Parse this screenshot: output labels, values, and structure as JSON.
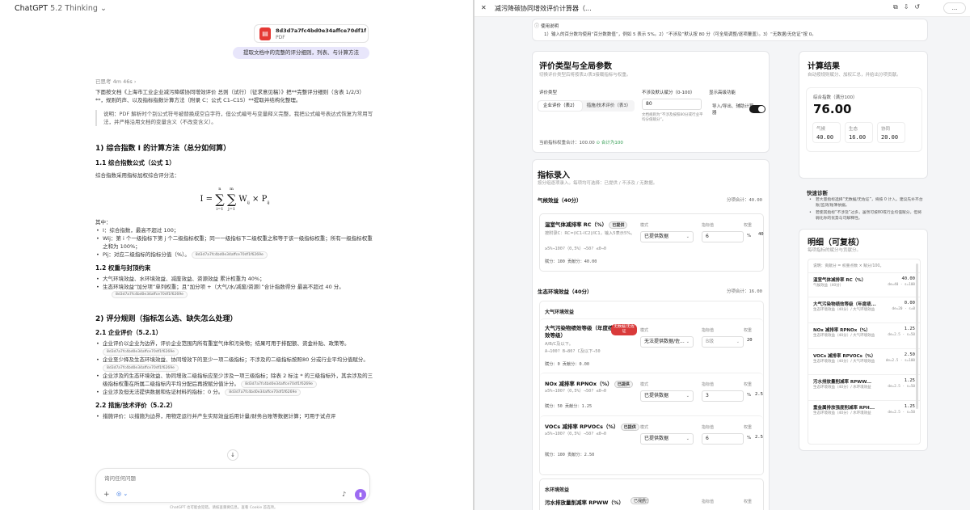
{
  "chat": {
    "title": "ChatGPT",
    "version": "5.2 Thinking",
    "file_name": "8d3d7a7fc4bd0e34affce70df1f62...",
    "file_type": "PDF",
    "user_message": "提取文档中的完整的评分细则，列表、与计算方法",
    "thought_time": "已思考 4m 46s",
    "intro": "下面按文档《上海市工业企业减污降碳协同增效评价 总则（试行）（征求意见稿）》把**完整评分细则（含表 1/2/3）**，规则的声、以及指标指数计算方法（附录 C：公式 C1–C15）**提取并结构化整理。",
    "note": "说明：PDF 解析时个别公式符号被替换成空白字符，但公式编号与变量释义完整，我把公式编号表达式恢复为常用写法，并严格沿用文档的变量含义（不改变含义）。",
    "sec1_title": "1) 综合指数 I 的计算方法（总分如何算）",
    "sec1_1_title": "1.1 综合指数公式（公式 1）",
    "sec1_1_text": "综合指数采用指标加权综合评分法：",
    "formula_lhs": "I =",
    "formula_n": "n",
    "formula_m": "m",
    "formula_i": "i=1",
    "formula_j": "j=1",
    "formula_body": "W",
    "formula_body_sub": "ij",
    "formula_times": "× P",
    "formula_p_sub": "ij",
    "where_label": "其中：",
    "where_items": [
      "I：综合指数，最高不超过 100；",
      "Wij：第 i 个一级指标下第 j 个二级指标权重；同一一级指标下二级权重之和等于该一级指标权重；所有一级指标权重之和为 100%；",
      "Pij：对应二级指标的指标分值（%）。"
    ],
    "ref_chip": "8d3d7a7fc4bd0e34affce70df1f6269e",
    "sec1_2_title": "1.2 权重与封顶约束",
    "sec1_2_items": [
      "大气环境效益、水环境效益、减废效益、资源效益 累计权重为 40%；",
      "生态环境效益“加分项”单列权重；且“加分项 +（大气/水/减废/资源）”合计指数得分 最高不超过 40 分。"
    ],
    "sec2_title": "2) 评分规则（指标怎么选、缺失怎么处理）",
    "sec2_1_title": "2.1 企业评价（5.2.1）",
    "sec2_1_items": [
      "企业评价以企业为边界，评价企业范围内所有重室气体和污染物；结果可用于排配额、资金补贴、政策等。",
      "企业至少择及生态环境效益、协同增效下的至少一项二级指标；不涉及的二级指标按照80 分或行业平均分值赋分。",
      "企业涉及的生态环境效益、协同增效二级指标应至少涉及一项三级指标；除表 2 标注 * 的三级指标外，其余涉及的三级指标权重在所属二级指标内平均分配后再按赋分值计分。",
      "企业涉及但无法提供数据和佐证材料的指标：0 分。"
    ],
    "sec2_2_title": "2.2 措施/技术评价（5.2.2）",
    "sec2_2_items": [
      "措施评价：以措施为边界，用物定运行并产生实际效益后用计量/财务台账等数据计算；可用于试点评"
    ],
    "composer_placeholder": "询问任何问题",
    "disclaimer": "ChatGPT 也可能会犯错。请核查重要信息。查看 Cookie 首选项。"
  },
  "canvas": {
    "title": "减污降碳协同增效评价计算器（...",
    "share_label": "...",
    "note_title": "使用说明",
    "note_text": "1）输入的百分数均使用“百分数数值”，例如 5 表示 5%。2）“不涉及”默认按 80 分（可全局调整/逐项覆盖）。3）“无数据/无佐证”按 0。",
    "params": {
      "title": "评价类型与全局参数",
      "subtitle": "切换评价类型后将按表2/表3接载指标与权重。",
      "type_label": "评价类型",
      "type_options": [
        "企业评价（表2）",
        "措施/技术评价（表3）"
      ],
      "default_label": "不涉及默认赋分（0-100）",
      "default_value": "80",
      "default_hint": "文档规则为“不涉及按照80分或行业平均分值赋分”。",
      "adv_label": "显示高级功能",
      "adv_text": "导入/导出、辅助计算器",
      "weight_total": "当前指标权重合计：100.00",
      "weight_ok": "合计为100"
    },
    "result": {
      "title": "计算结果",
      "subtitle": "自动按规则赋分、加权汇总，并给出分项贡献。",
      "total_label": "综合指数（满分100）",
      "total_value": "76.00",
      "subs": [
        {
          "label": "气候",
          "value": "40.00"
        },
        {
          "label": "生态",
          "value": "16.00"
        },
        {
          "label": "协同",
          "value": "20.00"
        }
      ]
    },
    "diag": {
      "title": "快速诊断",
      "items": [
        "若大量指标选择“无数据/无佐证”，将按 0 计入。建议先补齐台账/监测/账簿依据。",
        "若使其指标“不涉及”过多，虽然可按80或行业均值赋分，但将弱化你的优势与可解释性。"
      ]
    },
    "detail": {
      "title": "明细（可复核）",
      "subtitle": "每项指标的赋分与贡献分。",
      "header": "说明：贡献分 = 权重点数 × 赋分/100。",
      "rows": [
        {
          "name": "温室气体减排率 RC（%）",
          "cat": "气候效益（40分）",
          "value": "40.00",
          "detail": "de=40 · s=100"
        },
        {
          "name": "大气污染物绩效等级（年度绩...",
          "cat": "生态环境效益（40分）/ 大气环境效益",
          "value": "0.00",
          "detail": "de=20 · s=0"
        },
        {
          "name": "NOx 减排率 RPNOx（%）",
          "cat": "生态环境效益（40分）/ 大气环境效益",
          "value": "1.25",
          "detail": "de=2.5 · s=50"
        },
        {
          "name": "VOCs 减排率 RPVOCs（%）",
          "cat": "生态环境效益（40分）/ 大气环境效益",
          "value": "2.50",
          "detail": "de=2.5 · s=100"
        },
        {
          "name": "污水排放量削减率 RPWW...",
          "cat": "生态环境效益（40分）/ 水环境效益",
          "value": "1.25",
          "detail": "de=2.5 · s=50"
        },
        {
          "name": "重金属排放强度削减率 RPH...",
          "cat": "生态环境效益（40分）/ 水环境效益",
          "value": "1.25",
          "detail": "de=2.5 · s=50"
        }
      ]
    },
    "input": {
      "title": "指标录入",
      "subtitle": "按分组逐项录入。每项均可选择：已提供 / 不涉及 / 无数据。",
      "sec_climate": "气候效益（40分）",
      "sec_climate_score": "分项合计：40.00",
      "sec_eco": "生态环境效益（40分）",
      "sec_eco_score": "分项合计：16.00",
      "sub_air": "大气环境效益",
      "sub_water": "水环境效益",
      "col_mode": "模式",
      "col_value": "指标值",
      "col_weight": "权重",
      "items": [
        {
          "name": "温室气体减排率 RC（%）",
          "tag": "已提供",
          "desc": "按附录C：RC=(IC1-IC2)/IC1，输入5表示5%。",
          "rule": "≥5%→100?（0,5%）→50? ≤0→0",
          "score": "赋分：100  贡献分：40.00",
          "mode": "已提供数据",
          "value": "6",
          "weight": "40"
        },
        {
          "name": "大气污染物绩效等级（年度绩效等级）",
          "tag": "无数据/无佐证",
          "desc": "A/B/C及以下。",
          "rule": "A→100? B→80? C及以下→50",
          "score": "赋分：0  贡献分：0.00",
          "mode": "无法提供数据/佐...",
          "value": "B级",
          "weight": "20"
        },
        {
          "name": "NOx 减排率 RPNOx（%）",
          "tag": "已提供",
          "desc": "",
          "rule": "≥5%→100?（0,5%）→50? ≤0→0",
          "score": "赋分：50  贡献分：1.25",
          "mode": "已提供数据",
          "value": "3",
          "weight": "2.5"
        },
        {
          "name": "VOCs 减排率 RPVOCs（%）",
          "tag": "已提供",
          "desc": "",
          "rule": "≥5%→100?（0,5%）→50? ≤0→0",
          "score": "赋分：100  贡献分：2.50",
          "mode": "已提供数据",
          "value": "6",
          "weight": "2.5"
        },
        {
          "name": "污水排放量削减率 RPWW（%）",
          "tag": "已提供",
          "desc": "",
          "rule": "",
          "score": "",
          "mode": "",
          "value": "",
          "weight": ""
        }
      ]
    }
  }
}
